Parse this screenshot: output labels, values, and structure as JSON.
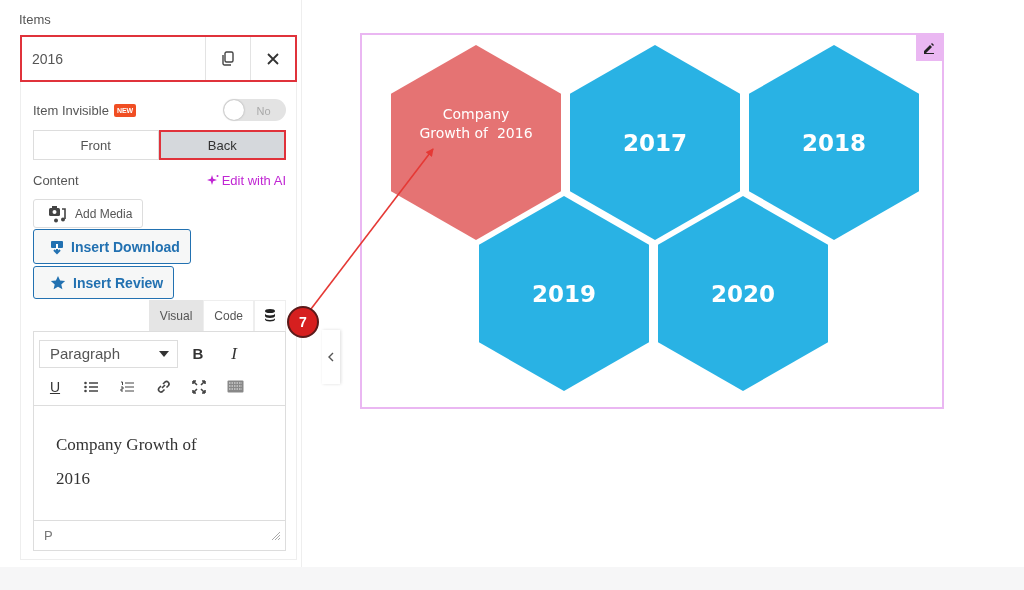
{
  "panel": {
    "section_title": "Items",
    "item": {
      "title": "2016",
      "highlighted": true
    },
    "item_invisible": {
      "label": "Item Invisible",
      "badge": "NEW",
      "toggle": {
        "on": false,
        "label": "No"
      }
    },
    "tabs": [
      {
        "label": "Front",
        "selected": false,
        "highlighted": false
      },
      {
        "label": "Back",
        "selected": true,
        "highlighted": true
      }
    ],
    "content_label": "Content",
    "ai_link": "Edit with AI",
    "media_buttons": [
      {
        "kind": "media",
        "label": "Add Media"
      },
      {
        "kind": "download",
        "label": "Insert Download"
      },
      {
        "kind": "review",
        "label": "Insert Review"
      }
    ],
    "editor_tabs": [
      {
        "label": "Visual",
        "selected": true
      },
      {
        "label": "Code",
        "selected": false
      }
    ],
    "editor": {
      "format": "Paragraph",
      "bold": "B",
      "italic": "I",
      "underline": "U",
      "text": "Company Growth of 2016",
      "status": "P"
    }
  },
  "callout": {
    "number": "7"
  },
  "canvas": {
    "hexagons": [
      {
        "kind": "caption",
        "label": "Company Growth of  2016",
        "color": "#e57373"
      },
      {
        "kind": "year",
        "label": "2017",
        "color": "#29b2e4"
      },
      {
        "kind": "year",
        "label": "2018",
        "color": "#29b2e4"
      },
      {
        "kind": "year",
        "label": "2019",
        "color": "#29b2e4"
      },
      {
        "kind": "year",
        "label": "2020",
        "color": "#29b2e4"
      }
    ]
  }
}
